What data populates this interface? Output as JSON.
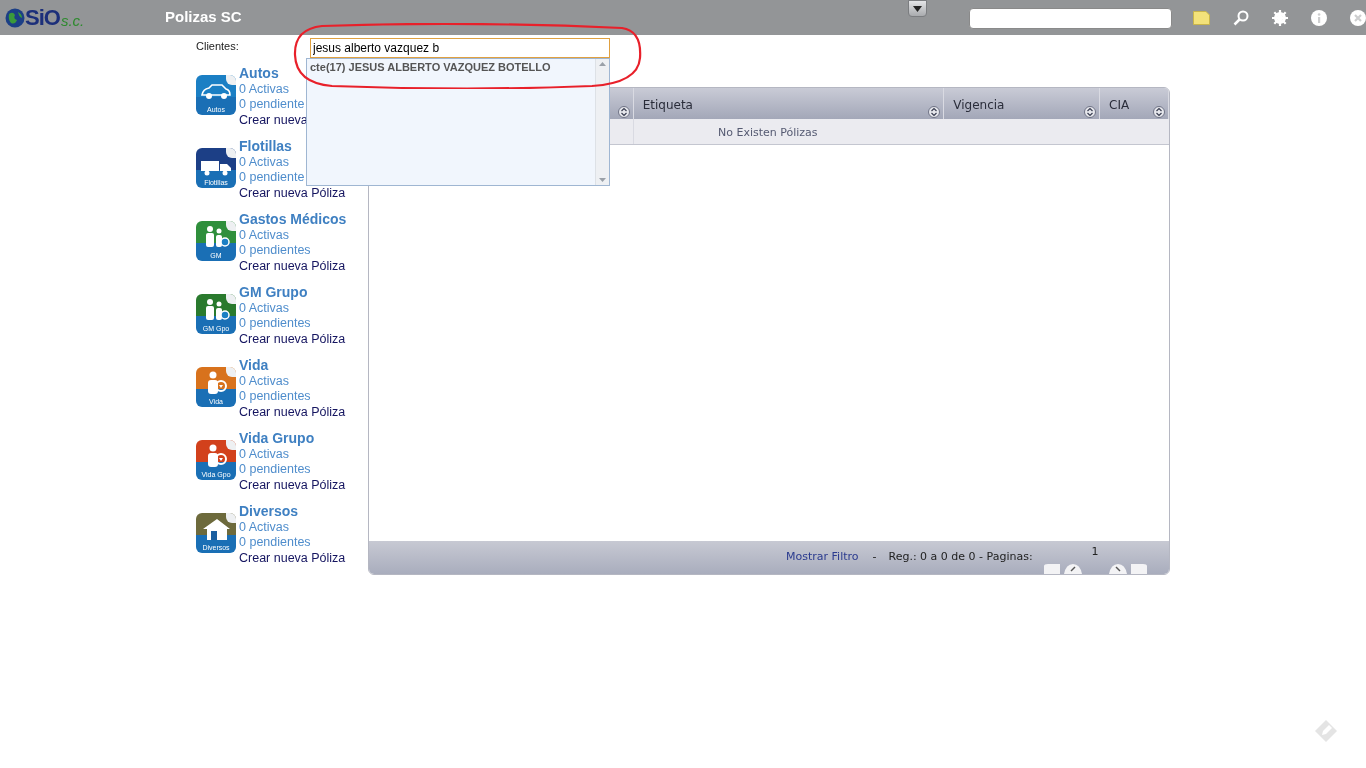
{
  "app": {
    "logo_main": "SiO",
    "logo_suffix": "s.c.",
    "title": "Polizas SC"
  },
  "clients": {
    "label": "Clientes:",
    "value": "jesus alberto vazquez b",
    "suggestions": [
      {
        "text": "cte(17) JESUS ALBERTO VAZQUEZ BOTELLO",
        "selected": false
      }
    ]
  },
  "categories": [
    {
      "kind": "car",
      "color": "#1b7fc4",
      "badge": "Autos",
      "title": "Autos",
      "activas": "0 Activas",
      "pendientes": "0 pendiente",
      "create": "Crear nueva"
    },
    {
      "kind": "truck",
      "color": "#1c3f86",
      "badge": "Flotillas",
      "title": "Flotillas",
      "activas": "0 Activas",
      "pendientes": "0 pendiente",
      "create": "Crear nueva Póliza"
    },
    {
      "kind": "medical",
      "color": "#2f8f3c",
      "badge": "GM",
      "title": "Gastos Médicos",
      "activas": "0 Activas",
      "pendientes": "0 pendientes",
      "create": "Crear nueva Póliza"
    },
    {
      "kind": "group",
      "color": "#2a7a2e",
      "badge": "GM Gpo",
      "title": "GM Grupo",
      "activas": "0 Activas",
      "pendientes": "0 pendientes",
      "create": "Crear nueva Póliza"
    },
    {
      "kind": "life",
      "color": "#d8721c",
      "badge": "Vida",
      "title": "Vida",
      "activas": "0 Activas",
      "pendientes": "0 pendientes",
      "create": "Crear nueva Póliza"
    },
    {
      "kind": "lifegroup",
      "color": "#d2411c",
      "badge": "Vida Gpo",
      "title": "Vida Grupo",
      "activas": "0 Activas",
      "pendientes": "0 pendientes",
      "create": "Crear nueva Póliza"
    },
    {
      "kind": "house",
      "color": "#6d6a3c",
      "badge": "Diversos",
      "title": "Diversos",
      "activas": "0 Activas",
      "pendientes": "0 pendientes",
      "create": "Crear nueva Póliza"
    }
  ],
  "table": {
    "columns": [
      {
        "sort": true
      },
      {
        "label": "Etiqueta",
        "sort": true
      },
      {
        "label": "Vigencia",
        "sort": true
      },
      {
        "label": "CIA",
        "sort": true
      }
    ],
    "empty_message": "No Existen Pólizas",
    "footer": {
      "filter_link": "Mostrar Filtro",
      "separator": "-",
      "records": "Reg.: 0 a 0 de 0 - Paginas:",
      "page": "1"
    }
  }
}
